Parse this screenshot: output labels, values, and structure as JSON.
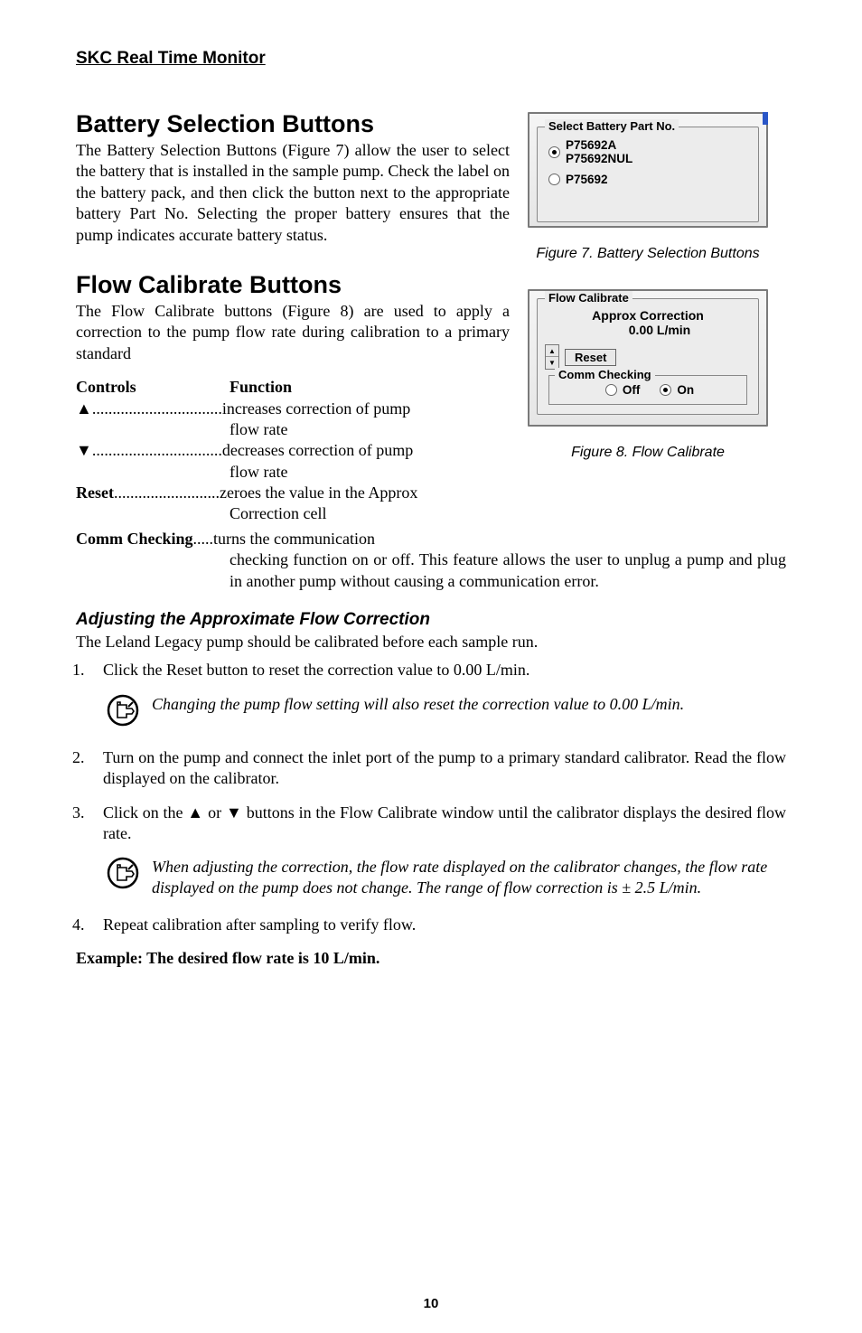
{
  "header": "SKC Real Time Monitor",
  "battery": {
    "heading": "Battery Selection Buttons",
    "body": "The Battery Selection Buttons (Figure 7) allow the user to select the battery that is installed in the sample pump. Check the label on the battery pack, and then click the button next to the appropriate battery Part No. Selecting the proper battery ensures that the pump indicates accurate battery status."
  },
  "flowcal": {
    "heading": "Flow Calibrate Buttons",
    "intro": "The Flow Calibrate buttons (Figure 8) are used to apply a correction to the pump flow rate during calibration to a primary standard"
  },
  "controls_heading_left": "Controls",
  "controls_heading_right": "Function",
  "rows": {
    "up": {
      "label": "▲",
      "dots": "................................",
      "fn1": "increases correction of pump",
      "fn2": "flow rate"
    },
    "down": {
      "label": "▼",
      "dots": "................................",
      "fn1": "decreases correction of pump",
      "fn2": "flow rate"
    },
    "reset": {
      "label": "Reset",
      "dots": "..........................",
      "fn1": "zeroes the value in the Approx",
      "fn2": "Correction cell"
    },
    "comm": {
      "label": "Comm Checking",
      "dots": ".....",
      "fn1": "turns the communication"
    }
  },
  "after_controls": "checking function on or off. This feature allows the user to unplug a pump and plug in another pump without causing a communication error.",
  "adjust": {
    "heading": "Adjusting the Approximate Flow Correction",
    "intro": "The Leland Legacy pump should be calibrated before each sample run.",
    "step1": "Click the Reset button to reset the correction value to 0.00 L/min.",
    "note1": "Changing the pump flow setting will also reset the correction value to 0.00 L/min.",
    "step2": "Turn on the pump and connect the inlet port of the pump to a primary standard calibrator. Read the flow displayed on the calibrator.",
    "step3": "Click on the ▲ or ▼ buttons in the Flow Calibrate window until the calibrator displays the desired flow rate.",
    "note2": "When adjusting the correction, the flow rate displayed on the calibrator changes, the flow rate displayed on the pump does not change. The range of flow correction is ± 2.5 L/min.",
    "step4": "Repeat calibration after sampling to verify flow."
  },
  "example": "Example: The desired flow rate is 10 L/min.",
  "fig7": {
    "group": "Select Battery Part No.",
    "opt1a": "P75692A",
    "opt1b": "P75692NUL",
    "opt2": "P75692",
    "caption": "Figure 7. Battery Selection Buttons"
  },
  "fig8": {
    "group": "Flow Calibrate",
    "approx": "Approx Correction",
    "value": "0.00 L/min",
    "reset": "Reset",
    "cc": "Comm Checking",
    "off": "Off",
    "on": "On",
    "caption": "Figure 8. Flow Calibrate"
  },
  "pagenum": "10"
}
